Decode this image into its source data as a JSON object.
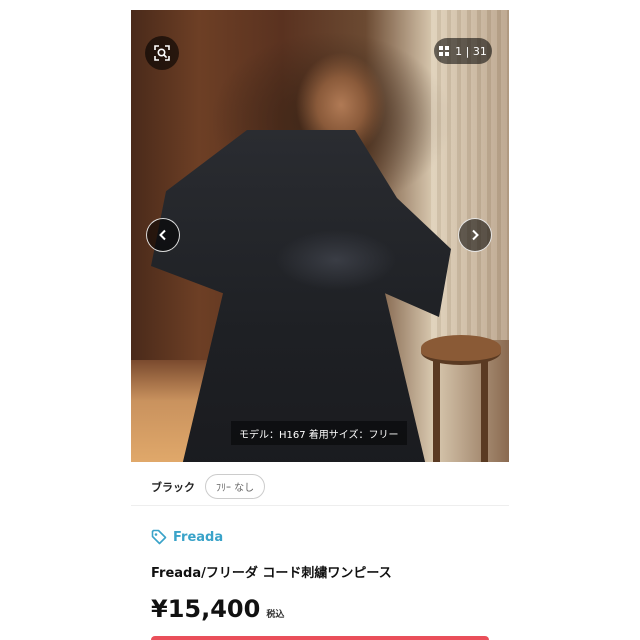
{
  "gallery": {
    "counter_current": "1",
    "counter_total": "31",
    "caption": "モデル：H167 着用サイズ：フリー"
  },
  "icons": {
    "zoom": "zoom-search-icon",
    "grid": "grid-icon",
    "prev": "chevron-left-icon",
    "next": "chevron-right-icon",
    "tag": "tag-icon"
  },
  "variant": {
    "color": "ブラック",
    "size": "ﾌﾘｰ なし"
  },
  "product": {
    "brand": "Freada",
    "title": "Freada/フリーダ コード刺繍ワンピース",
    "price": "¥15,400",
    "tax_label": "税込"
  },
  "colors": {
    "brand_accent": "#3aa3c9",
    "buy_button": "#ea4f5a"
  }
}
